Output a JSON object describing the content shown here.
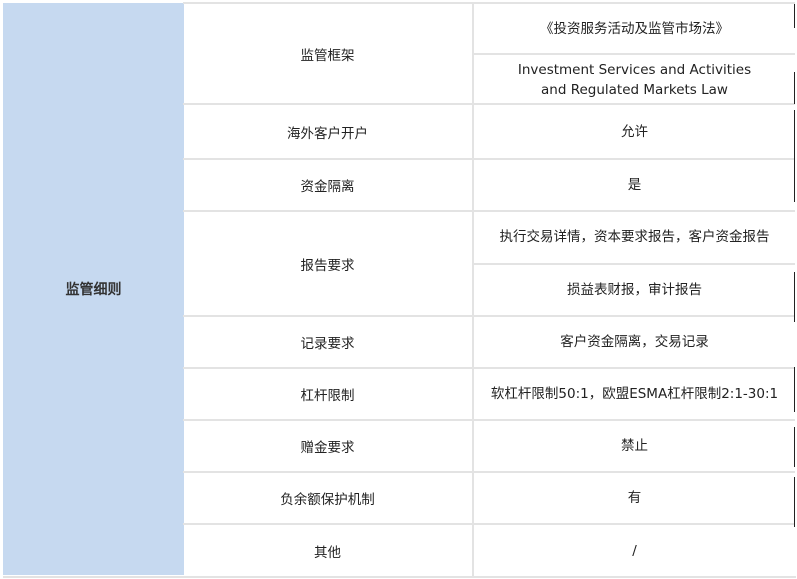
{
  "category": "监管细则",
  "rows": [
    {
      "label": "监管框架",
      "values": [
        "《投资服务活动及监管市场法》",
        "Investment Services and Activities and Regulated Markets Law"
      ]
    },
    {
      "label": "海外客户开户",
      "values": [
        "允许"
      ]
    },
    {
      "label": "资金隔离",
      "values": [
        "是"
      ]
    },
    {
      "label": "报告要求",
      "values": [
        "执行交易详情，资本要求报告，客户资金报告",
        "损益表财报，审计报告"
      ]
    },
    {
      "label": "记录要求",
      "values": [
        "客户资金隔离，交易记录"
      ]
    },
    {
      "label": "杠杆限制",
      "values": [
        "软杠杆限制50:1，欧盟ESMA杠杆限制2:1-30:1"
      ]
    },
    {
      "label": "赠金要求",
      "values": [
        "禁止"
      ]
    },
    {
      "label": "负余额保护机制",
      "values": [
        "有"
      ]
    },
    {
      "label": "其他",
      "values": [
        "/"
      ]
    }
  ]
}
